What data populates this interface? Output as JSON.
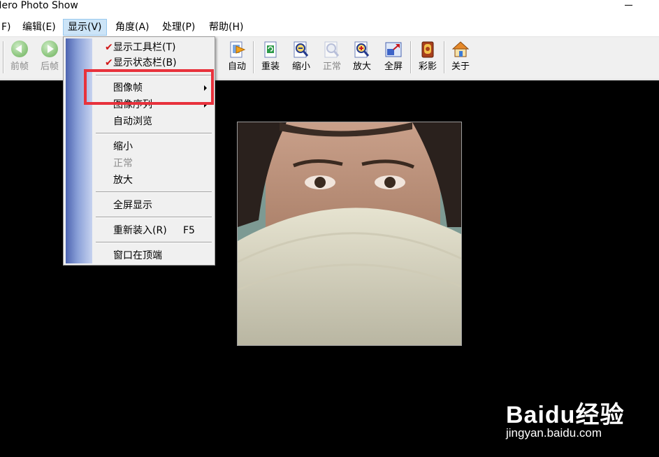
{
  "window": {
    "title": "Hero Photo Show"
  },
  "menubar": {
    "items": [
      {
        "label": "F)"
      },
      {
        "label": "编辑(E)"
      },
      {
        "label": "显示(V)"
      },
      {
        "label": "角度(A)"
      },
      {
        "label": "处理(P)"
      },
      {
        "label": "帮助(H)"
      }
    ]
  },
  "toolbar": {
    "buttons": [
      {
        "label": "前帧",
        "icon": "prev-frame-icon",
        "enabled": false
      },
      {
        "label": "后帧",
        "icon": "next-frame-icon",
        "enabled": false
      },
      {
        "label": "自动",
        "icon": "auto-play-icon",
        "enabled": true
      },
      {
        "label": "重装",
        "icon": "reload-icon",
        "enabled": true
      },
      {
        "label": "缩小",
        "icon": "zoom-out-icon",
        "enabled": true
      },
      {
        "label": "正常",
        "icon": "zoom-normal-icon",
        "enabled": false
      },
      {
        "label": "放大",
        "icon": "zoom-in-icon",
        "enabled": true
      },
      {
        "label": "全屏",
        "icon": "fullscreen-icon",
        "enabled": true
      },
      {
        "label": "彩影",
        "icon": "color-shadow-icon",
        "enabled": true
      },
      {
        "label": "关于",
        "icon": "about-home-icon",
        "enabled": true
      }
    ]
  },
  "dropdown": {
    "items": [
      {
        "label": "显示工具栏(T)",
        "checked": true
      },
      {
        "label": "显示状态栏(B)",
        "checked": true
      },
      {
        "label": "图像帧",
        "submenu": true
      },
      {
        "label": "图像序列",
        "submenu": true
      },
      {
        "label": "自动浏览"
      },
      {
        "label": "缩小"
      },
      {
        "label": "正常",
        "disabled": true
      },
      {
        "label": "放大"
      },
      {
        "label": "全屏显示"
      },
      {
        "label": "重新装入(R)",
        "shortcut": "F5"
      },
      {
        "label": "窗口在顶端"
      }
    ],
    "check_mark": "✔"
  },
  "watermark": {
    "brand": "Baidu经验",
    "site": "jingyan.baidu.com"
  },
  "colors": {
    "highlight": "#e8323c",
    "menu_active": "#cce4f7",
    "stripe": "#4d64b0"
  }
}
